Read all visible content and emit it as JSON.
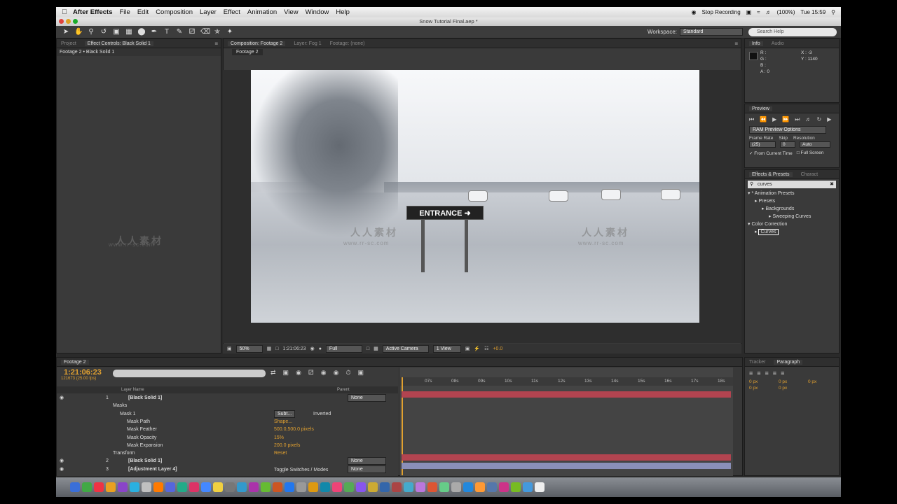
{
  "menubar": {
    "app_name": "After Effects",
    "items": [
      "File",
      "Edit",
      "Composition",
      "Layer",
      "Effect",
      "Animation",
      "View",
      "Window",
      "Help"
    ],
    "stop_recording": "Stop Recording",
    "battery": "(100%)",
    "clock": "Tue 15:59"
  },
  "window_title": "Snow Tutorial Final.aep *",
  "watermark": {
    "url": "www.rr-sc.com",
    "cn": "人人素材"
  },
  "toolbar": {
    "workspace_label": "Workspace:",
    "workspace_value": "Standard",
    "search_placeholder": "Search Help"
  },
  "left_panel": {
    "tab_project": "Project",
    "tab_effect_controls": "Effect Controls: Black Solid 1",
    "breadcrumb": "Footage 2 • Black Solid 1"
  },
  "comp_panel": {
    "tab_comp": "Composition: Footage 2",
    "tab_layer": "Layer: Fog 1",
    "tab_footage": "Footage: (none)",
    "sub_tab": "Footage 2",
    "sign_text": "ENTRANCE"
  },
  "viewer_footer": {
    "zoom": "50%",
    "timecode": "1:21:06:23",
    "resolution": "Full",
    "camera": "Active Camera",
    "views": "1 View",
    "exposure": "+0.0"
  },
  "info_panel": {
    "tab_info": "Info",
    "tab_audio": "Audio",
    "r": "R :",
    "g": "G :",
    "b": "B :",
    "a": "A : 0",
    "x": "X : -3",
    "y": "Y : 1140"
  },
  "preview_panel": {
    "title": "Preview",
    "ram_options": "RAM Preview Options",
    "frame_rate_label": "Frame Rate",
    "skip_label": "Skip",
    "resolution_label": "Resolution",
    "frame_rate": "(25)",
    "skip": "0",
    "resolution": "Auto",
    "from_current": "From Current Time",
    "full_screen": "Full Screen"
  },
  "effects_panel": {
    "tab_effects": "Effects & Presets",
    "tab_character": "Charact",
    "search_value": "curves",
    "tree": [
      {
        "label": "* Animation Presets",
        "indent": 0
      },
      {
        "label": "Presets",
        "indent": 1
      },
      {
        "label": "Backgrounds",
        "indent": 2
      },
      {
        "label": "Sweeping Curves",
        "indent": 3
      },
      {
        "label": "Color Correction",
        "indent": 0
      },
      {
        "label": "Curves",
        "indent": 1
      }
    ]
  },
  "paragraph_panel": {
    "tab_tracker": "Tracker",
    "tab_paragraph": "Paragraph",
    "fields": [
      "0 px",
      "0 px",
      "0 px",
      "0 px",
      "0 px"
    ]
  },
  "timeline": {
    "tab": "Footage 2",
    "timecode": "1:21:06:23",
    "fps": "121673 (25.00 fps)",
    "col_layer_name": "Layer Name",
    "col_parent": "Parent",
    "ruler": [
      "07s",
      "08s",
      "09s",
      "10s",
      "11s",
      "12s",
      "13s",
      "14s",
      "15s",
      "16s",
      "17s",
      "18s"
    ],
    "rows": [
      {
        "num": "1",
        "name": "[Black Solid 1]",
        "parent": "None"
      },
      {
        "name": "Masks"
      },
      {
        "name": "Mask 1",
        "mode": "Subt...",
        "inverted": "Inverted"
      },
      {
        "name": "Mask Path",
        "value": "Shape..."
      },
      {
        "name": "Mask Feather",
        "value": "500.0,500.0 pixels"
      },
      {
        "name": "Mask Opacity",
        "value": "15%"
      },
      {
        "name": "Mask Expansion",
        "value": "200.0 pixels"
      },
      {
        "name": "Transform",
        "value": "Reset"
      },
      {
        "num": "2",
        "name": "[Black Solid 1]",
        "parent": "None"
      },
      {
        "num": "3",
        "name": "[Adjustment Layer 4]",
        "parent": "None"
      }
    ],
    "toggle_label": "Toggle Switches / Modes"
  }
}
